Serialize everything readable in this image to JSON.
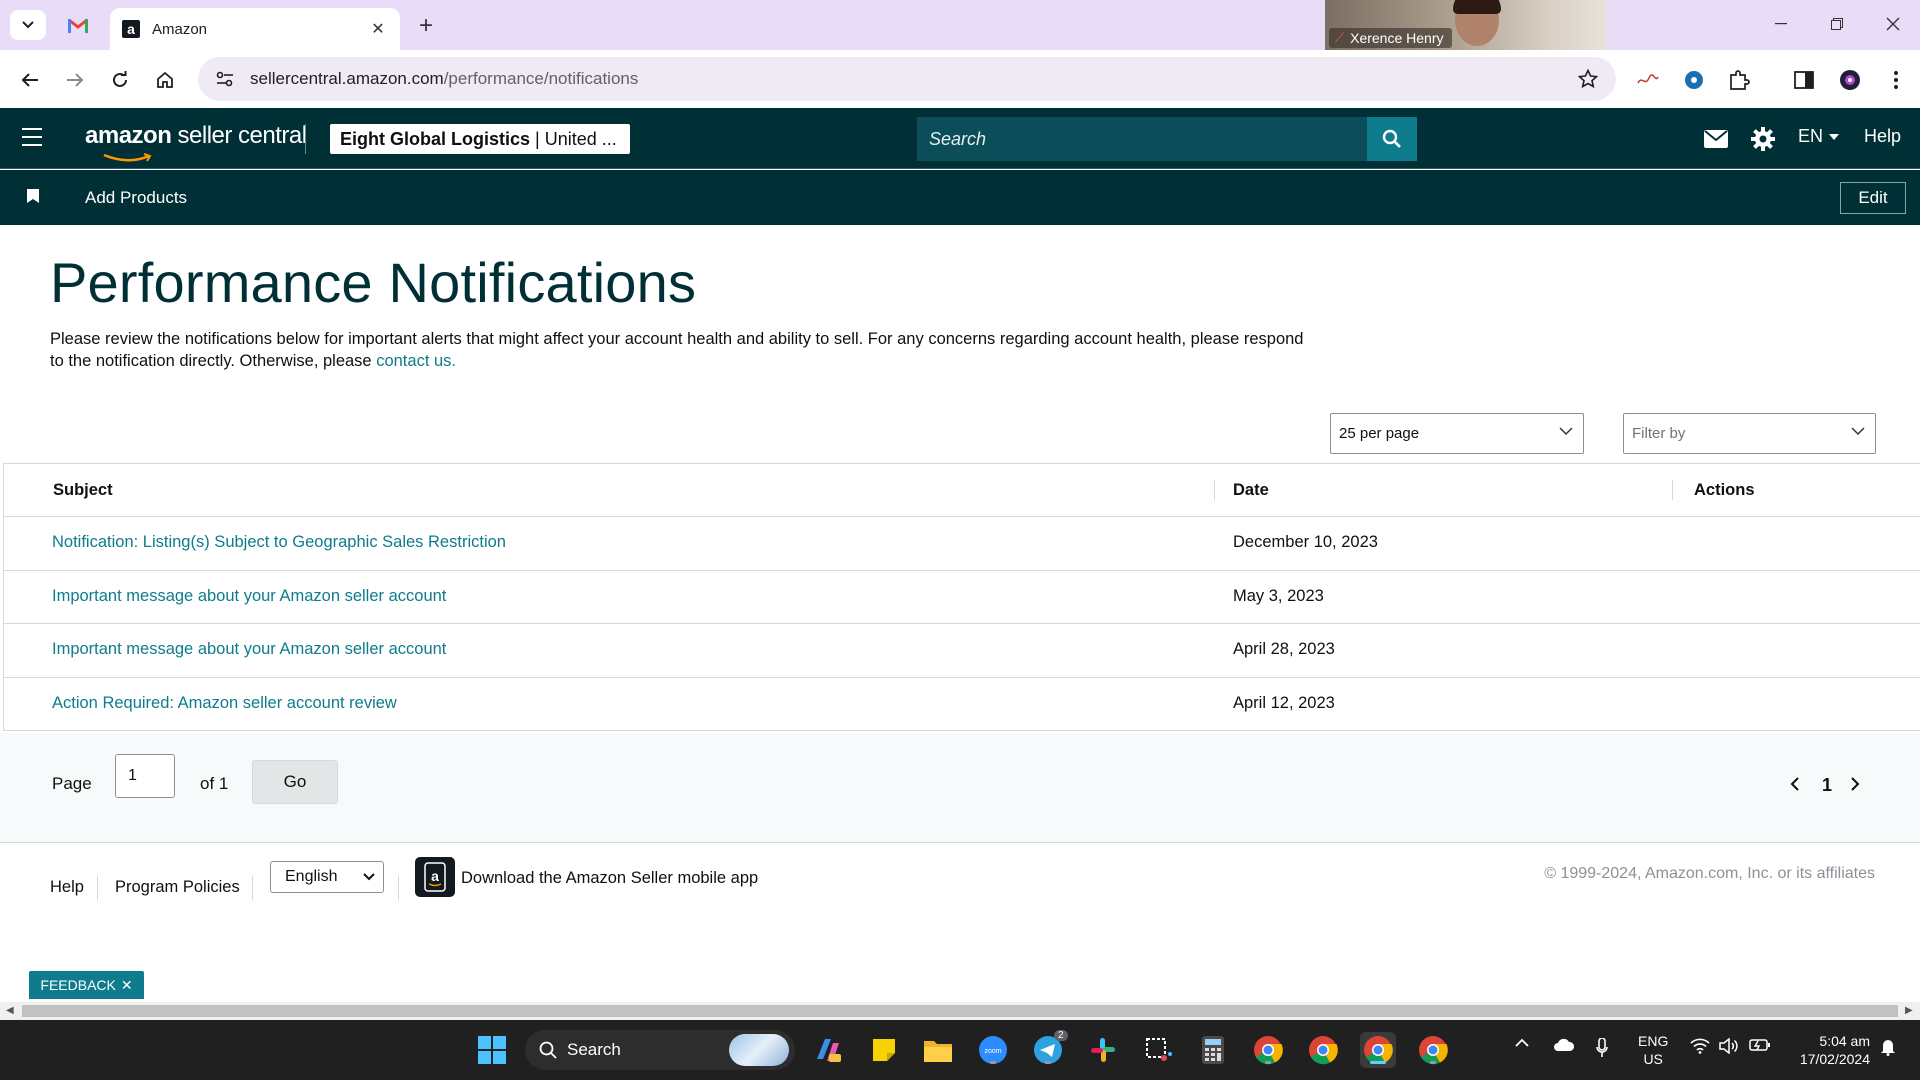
{
  "browser": {
    "tab_title": "Amazon",
    "url_host": "sellercentral.amazon.com",
    "url_path": "/performance/notifications",
    "video_participant": "Xerence Henry"
  },
  "header": {
    "logo_bold": "amazon",
    "logo_rest": " seller central",
    "account_name": "Eight Global Logistics",
    "account_separator": "|",
    "account_region": "United ...",
    "search_placeholder": "Search",
    "language": "EN",
    "help": "Help"
  },
  "subnav": {
    "add_products": "Add Products",
    "edit": "Edit"
  },
  "page": {
    "title": "Performance Notifications",
    "description": "Please review the notifications below for important alerts that might affect your account health and ability to sell. For any concerns regarding account health, please respond to the notification directly. Otherwise, please ",
    "contact_link": "contact us."
  },
  "controls": {
    "per_page": "25 per page",
    "filter_by": "Filter by"
  },
  "table": {
    "headers": {
      "subject": "Subject",
      "date": "Date",
      "actions": "Actions"
    },
    "rows": [
      {
        "subject": "Notification: Listing(s) Subject to Geographic Sales Restriction",
        "date": "December 10, 2023"
      },
      {
        "subject": "Important message about your Amazon seller account",
        "date": "May 3, 2023"
      },
      {
        "subject": "Important message about your Amazon seller account",
        "date": "April 28, 2023"
      },
      {
        "subject": "Action Required: Amazon seller account review",
        "date": "April 12, 2023"
      }
    ]
  },
  "pager": {
    "page_label": "Page",
    "page_value": "1",
    "of_label": "of 1",
    "go": "Go",
    "current": "1"
  },
  "footer": {
    "help": "Help",
    "policies": "Program Policies",
    "language": "English",
    "app": "Download the Amazon Seller mobile app",
    "copyright": "© 1999-2024, Amazon.com, Inc. or its affiliates"
  },
  "feedback": "FEEDBACK",
  "taskbar": {
    "search": "Search",
    "telegram_badge": "2",
    "lang": "ENG",
    "region": "US",
    "time": "5:04 am",
    "date": "17/02/2024"
  },
  "colors": {
    "header_bg": "#002f36",
    "link": "#0e7c8c",
    "search_bg": "#0b4d58",
    "search_btn": "#0e7c8c"
  }
}
